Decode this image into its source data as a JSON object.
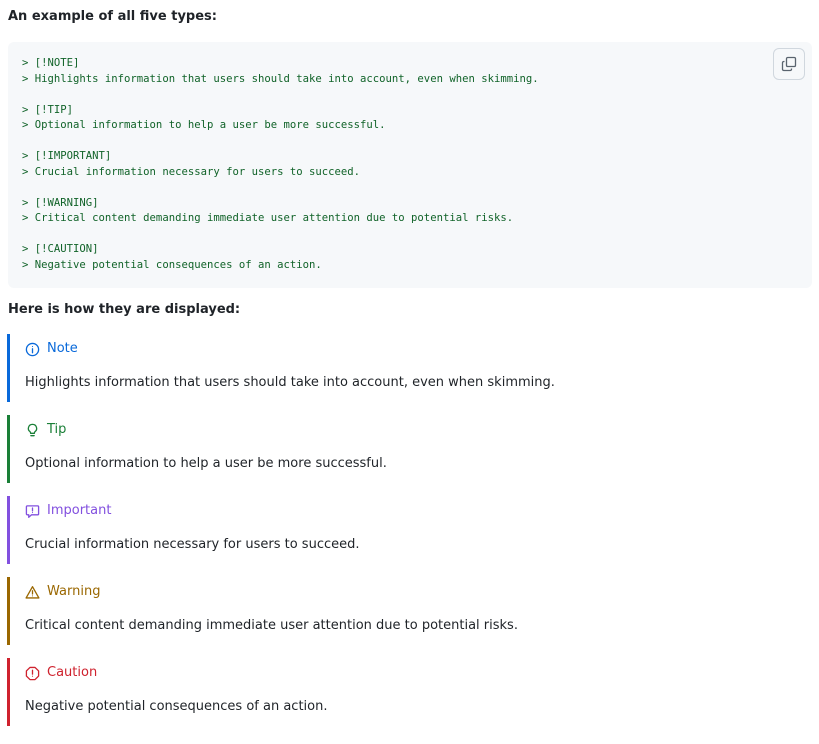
{
  "headings": {
    "example": "An example of all five types:",
    "display": "Here is how they are displayed:"
  },
  "code_block": {
    "lines": [
      [
        "> [!NOTE]",
        "> Highlights information that users should take into account, even when skimming."
      ],
      [
        "> [!TIP]",
        "> Optional information to help a user be more successful."
      ],
      [
        "> [!IMPORTANT]",
        "> Crucial information necessary for users to succeed."
      ],
      [
        "> [!WARNING]",
        "> Critical content demanding immediate user attention due to potential risks."
      ],
      [
        "> [!CAUTION]",
        "> Negative potential consequences of an action."
      ]
    ],
    "copy_icon": "copy-icon"
  },
  "alerts": [
    {
      "type": "note",
      "title": "Note",
      "body": "Highlights information that users should take into account, even when skimming.",
      "color": "#0969da",
      "icon": "info-icon"
    },
    {
      "type": "tip",
      "title": "Tip",
      "body": "Optional information to help a user be more successful.",
      "color": "#1a7f37",
      "icon": "light-bulb-icon"
    },
    {
      "type": "important",
      "title": "Important",
      "body": "Crucial information necessary for users to succeed.",
      "color": "#8250df",
      "icon": "report-icon"
    },
    {
      "type": "warning",
      "title": "Warning",
      "body": "Critical content demanding immediate user attention due to potential risks.",
      "color": "#9a6700",
      "icon": "alert-icon"
    },
    {
      "type": "caution",
      "title": "Caution",
      "body": "Negative potential consequences of an action.",
      "color": "#cf222e",
      "icon": "stop-icon"
    }
  ]
}
